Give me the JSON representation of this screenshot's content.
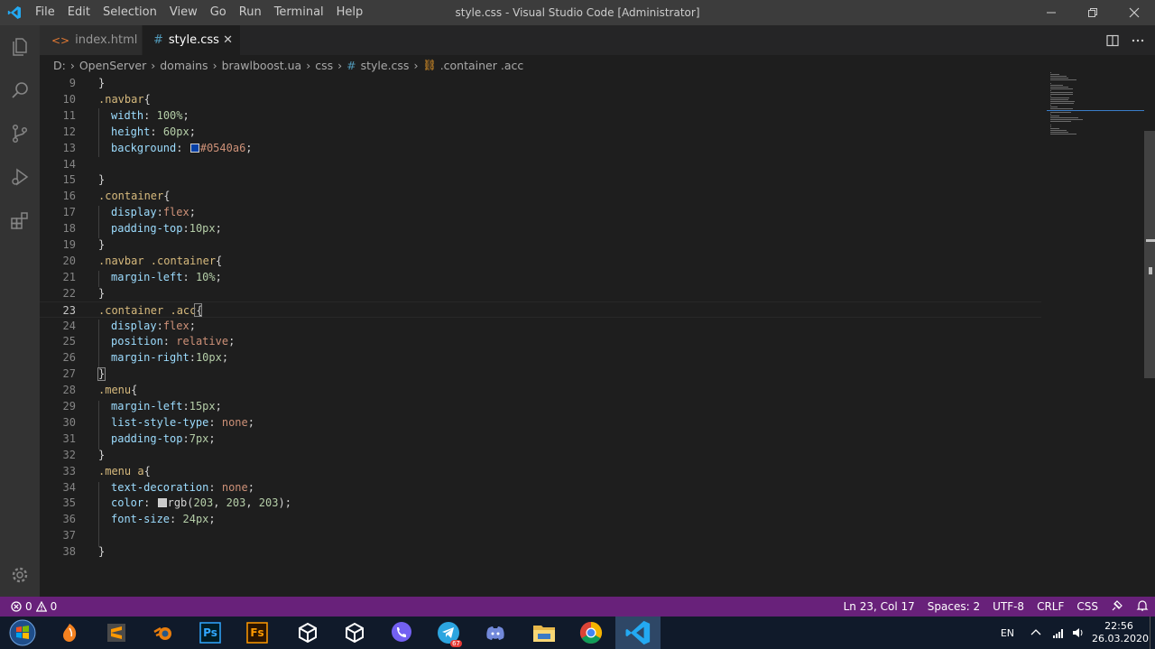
{
  "window": {
    "title": "style.css - Visual Studio Code [Administrator]",
    "menu": [
      "File",
      "Edit",
      "Selection",
      "View",
      "Go",
      "Run",
      "Terminal",
      "Help"
    ],
    "controls": [
      "minimize-icon",
      "restore-icon",
      "close-icon"
    ]
  },
  "activity_bar": [
    "explorer-icon",
    "search-icon",
    "source-control-icon",
    "run-debug-icon",
    "extensions-icon",
    "settings-gear-icon"
  ],
  "tabs": [
    {
      "label": "index.html",
      "icon": "<>",
      "active": false
    },
    {
      "label": "style.css",
      "icon": "#",
      "active": true,
      "close": "✕"
    }
  ],
  "breadcrumb": {
    "parts": [
      "D:",
      "OpenServer",
      "domains",
      "brawlboost.ua",
      "css"
    ],
    "file": "style.css",
    "symbol": ".container .acc"
  },
  "editor": {
    "cursor_line": 23,
    "lines": [
      {
        "n": "9",
        "text": "}"
      },
      {
        "n": "10",
        "text": ".navbar{"
      },
      {
        "n": "11",
        "text": "  width: 100%;"
      },
      {
        "n": "12",
        "text": "  height: 60px;"
      },
      {
        "n": "13",
        "text": "  background: #0540a6;"
      },
      {
        "n": "14",
        "text": ""
      },
      {
        "n": "15",
        "text": "}"
      },
      {
        "n": "16",
        "text": ".container{"
      },
      {
        "n": "17",
        "text": "  display:flex;"
      },
      {
        "n": "18",
        "text": "  padding-top:10px;"
      },
      {
        "n": "19",
        "text": "}"
      },
      {
        "n": "20",
        "text": ".navbar .container{"
      },
      {
        "n": "21",
        "text": "  margin-left: 10%;"
      },
      {
        "n": "22",
        "text": "}"
      },
      {
        "n": "23",
        "text": ".container .acc{"
      },
      {
        "n": "24",
        "text": "  display:flex;"
      },
      {
        "n": "25",
        "text": "  position: relative;"
      },
      {
        "n": "26",
        "text": "  margin-right:10px;"
      },
      {
        "n": "27",
        "text": "}"
      },
      {
        "n": "28",
        "text": ".menu{"
      },
      {
        "n": "29",
        "text": "  margin-left:15px;"
      },
      {
        "n": "30",
        "text": "  list-style-type: none;"
      },
      {
        "n": "31",
        "text": "  padding-top:7px;"
      },
      {
        "n": "32",
        "text": "}"
      },
      {
        "n": "33",
        "text": ".menu a{"
      },
      {
        "n": "34",
        "text": "  text-decoration: none;"
      },
      {
        "n": "35",
        "text": "  color: rgb(203, 203, 203);"
      },
      {
        "n": "36",
        "text": "  font-size: 24px;"
      },
      {
        "n": "37",
        "text": ""
      },
      {
        "n": "38",
        "text": "}"
      }
    ],
    "swatches": {
      "navbar_bg": "#0540a6",
      "menu_color": "#cbcbcb"
    }
  },
  "status_bar": {
    "errors": "0",
    "warnings": "0",
    "position": "Ln 23, Col 17",
    "spaces": "Spaces: 2",
    "encoding": "UTF-8",
    "eol": "CRLF",
    "language": "CSS",
    "color": "#68217a"
  },
  "taskbar": {
    "apps": [
      "start-icon",
      "fl-studio-icon",
      "sublime-text-icon",
      "blender-icon",
      "photoshop-icon",
      "fuse-icon",
      "unity-icon",
      "unity-icon",
      "viber-icon",
      "telegram-icon",
      "discord-icon",
      "file-explorer-icon",
      "chrome-icon",
      "vscode-icon"
    ],
    "telegram_badge": "67",
    "photoshop_label": "Ps",
    "fuse_label": "Fs",
    "language": "EN",
    "time": "22:56",
    "date": "26.03.2020"
  }
}
